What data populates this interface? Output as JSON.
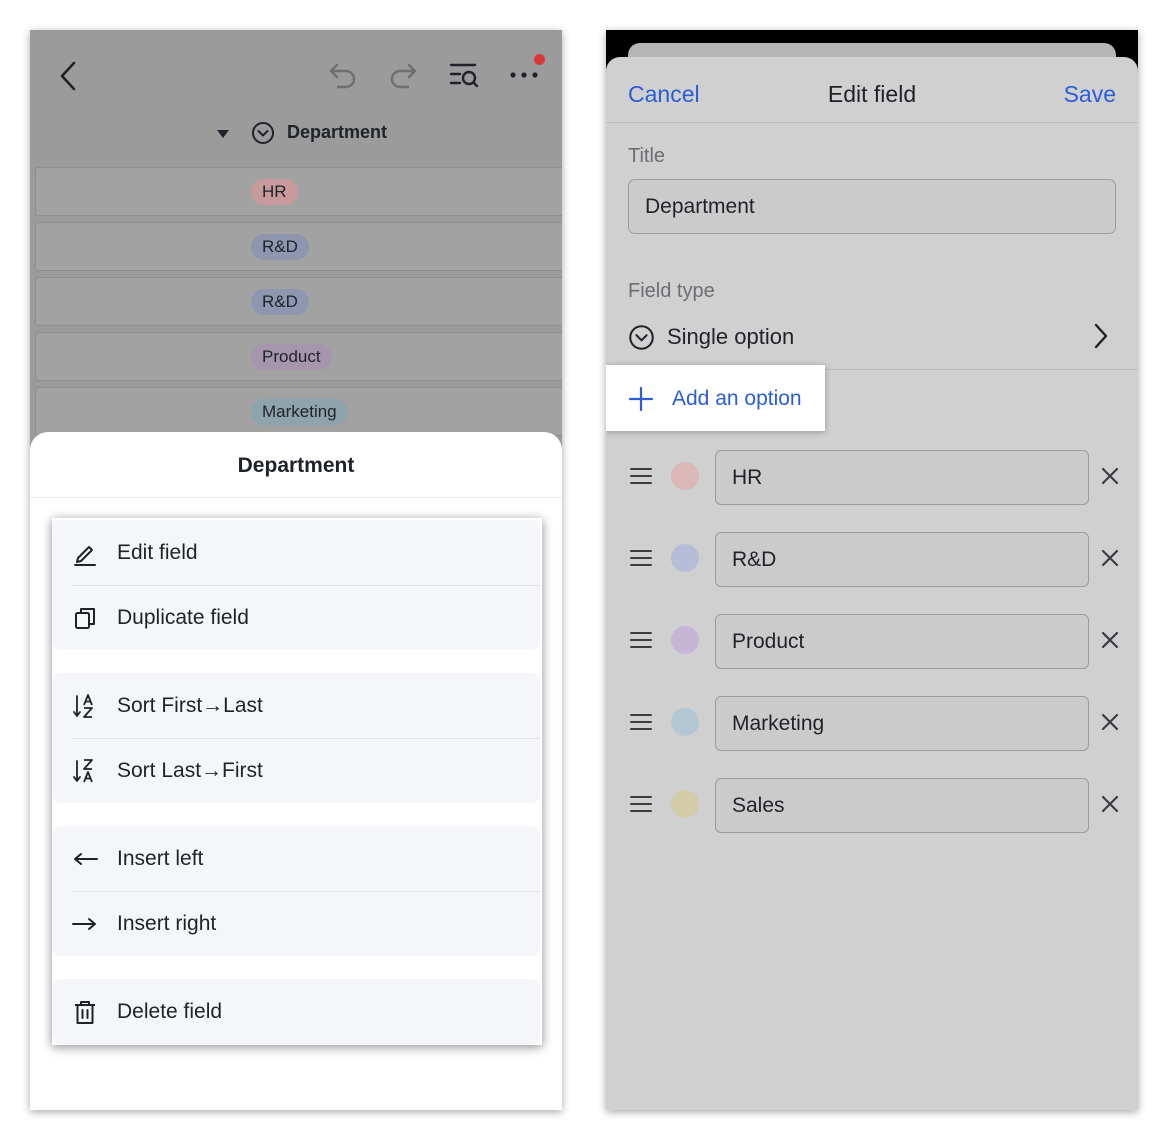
{
  "left_screen": {
    "column_header": {
      "title": "Department"
    },
    "rows": [
      {
        "label": "HR",
        "color": "#c79a9b"
      },
      {
        "label": "R&D",
        "color": "#8f97b0"
      },
      {
        "label": "R&D",
        "color": "#8f97b0"
      },
      {
        "label": "Product",
        "color": "#a596ad"
      },
      {
        "label": "Marketing",
        "color": "#8fa3ad"
      }
    ],
    "sheet": {
      "title": "Department",
      "groups": [
        [
          {
            "label": "Edit field",
            "icon": "edit-icon"
          },
          {
            "label": "Duplicate field",
            "icon": "duplicate-icon"
          }
        ],
        [
          {
            "label": "Sort First→Last",
            "icon": "sort-ascending-icon"
          },
          {
            "label": "Sort Last→First",
            "icon": "sort-descending-icon"
          }
        ],
        [
          {
            "label": "Insert left",
            "icon": "arrow-left-icon"
          },
          {
            "label": "Insert right",
            "icon": "arrow-right-icon"
          }
        ],
        [
          {
            "label": "Delete field",
            "icon": "trash-icon"
          }
        ]
      ]
    }
  },
  "right_screen": {
    "nav": {
      "cancel": "Cancel",
      "title": "Edit field",
      "save": "Save"
    },
    "title_label": "Title",
    "title_value": "Department",
    "field_type_label": "Field type",
    "field_type_value": "Single option",
    "add_option_label": "Add an option",
    "options": [
      {
        "label": "HR",
        "color": "#dcb7b8"
      },
      {
        "label": "R&D",
        "color": "#b7bcd8"
      },
      {
        "label": "Product",
        "color": "#c6b6d6"
      },
      {
        "label": "Marketing",
        "color": "#b3c7d2"
      },
      {
        "label": "Sales",
        "color": "#d4cba7"
      }
    ]
  },
  "colors": {
    "accent_blue": "#2a5dd6",
    "notification_red": "#d83a3a"
  }
}
